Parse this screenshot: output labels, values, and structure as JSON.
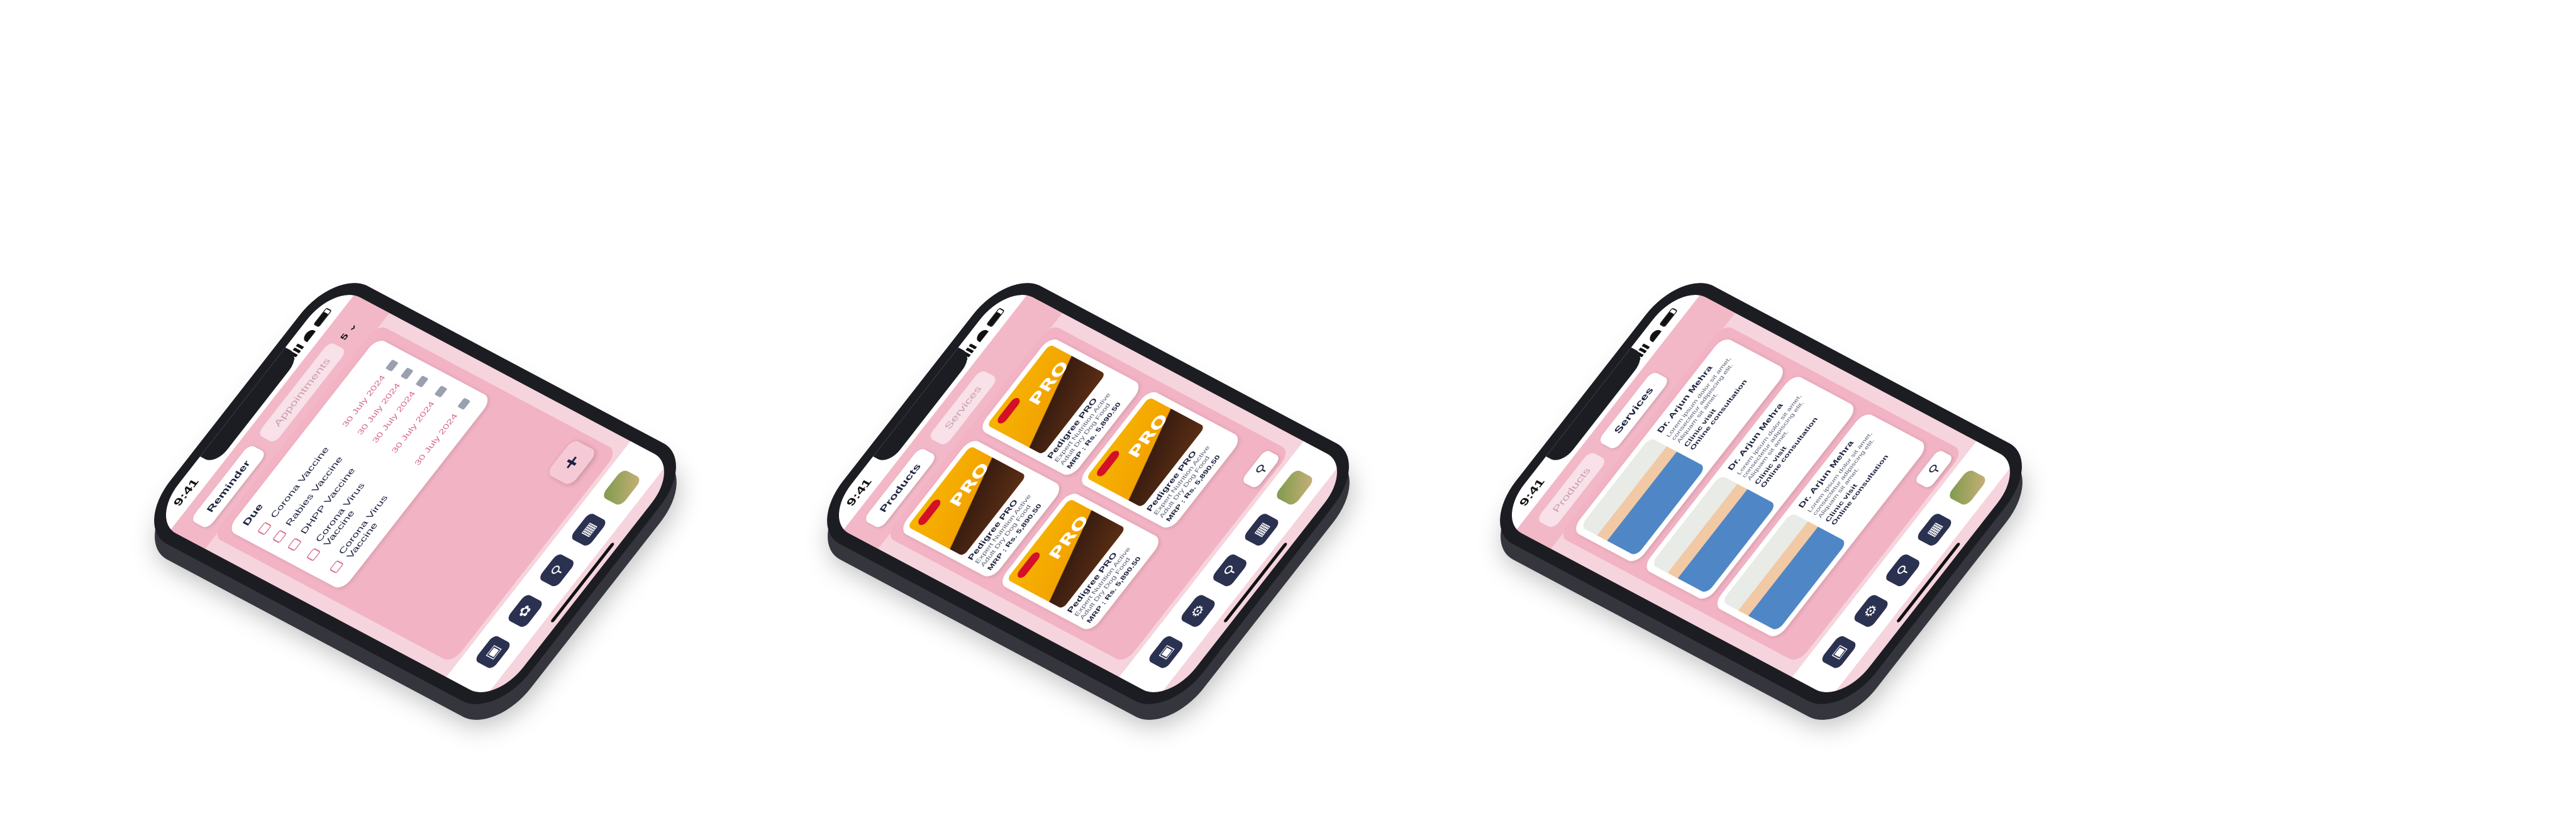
{
  "status_bar": {
    "time": "9:41"
  },
  "phone1": {
    "tabs": [
      "Reminder",
      "Appointments"
    ],
    "dropdown": "5",
    "section_title": "Due",
    "reminders": [
      {
        "name": "Corona Vaccine",
        "date": "30 July 2024"
      },
      {
        "name": "Rabies Vaccine",
        "date": "30 July 2024"
      },
      {
        "name": "DHPP Vaccine",
        "date": "30 July 2024"
      },
      {
        "name": "Corona Virus Vaccine",
        "date": "30 July 2024"
      },
      {
        "name": "Corona Virus Vaccine",
        "date": "30 July 2024"
      }
    ],
    "fab_label": "+"
  },
  "phone2": {
    "tabs": [
      "Products",
      "Services"
    ],
    "products": [
      {
        "brand": "PRO",
        "name": "Pedigree PRO",
        "desc": "Expert Nutrition Active Adult Dry Dog Food",
        "mrp": "MRP : Rs. 5,890.50"
      },
      {
        "brand": "PRO",
        "name": "Pedigree PRO",
        "desc": "Expert Nutrition Active Adult Dry Dog Food",
        "mrp": "MRP : Rs. 5,890.50"
      },
      {
        "brand": "PRO",
        "name": "Pedigree PRO",
        "desc": "Expert Nutrition Active Adult Dry Dog Food",
        "mrp": "MRP : Rs. 5,890.50"
      },
      {
        "brand": "PRO",
        "name": "Pedigree PRO",
        "desc": "Expert Nutrition Active Adult Dry Dog Food",
        "mrp": "MRP : Rs. 5,890.50"
      }
    ]
  },
  "phone3": {
    "tabs": [
      "Products",
      "Services"
    ],
    "doctors": [
      {
        "name": "Dr. Arjun Mehra",
        "bio": "Lorem ipsum dolor sit amet, consectetur adipiscing elit. Aliquam sit amet.",
        "tags": [
          "Clinic visit",
          "Online consultation"
        ]
      },
      {
        "name": "Dr. Arjun Mehra",
        "bio": "Lorem ipsum dolor sit amet, consectetur adipiscing elit. Aliquam sit amet.",
        "tags": [
          "Clinic visit",
          "Online consultation"
        ]
      },
      {
        "name": "Dr. Arjun Mehra",
        "bio": "Lorem ipsum dolor sit amet, consectetur adipiscing elit. Aliquam sit amet.",
        "tags": [
          "Clinic visit",
          "Online consultation"
        ]
      }
    ]
  },
  "nav_icons": [
    "home-icon",
    "pet-icon",
    "search-icon",
    "calendar-icon",
    "avatar"
  ],
  "colors": {
    "accent": "#f2b3c4",
    "navy": "#1d2340",
    "date_pink": "#d86b8a"
  }
}
